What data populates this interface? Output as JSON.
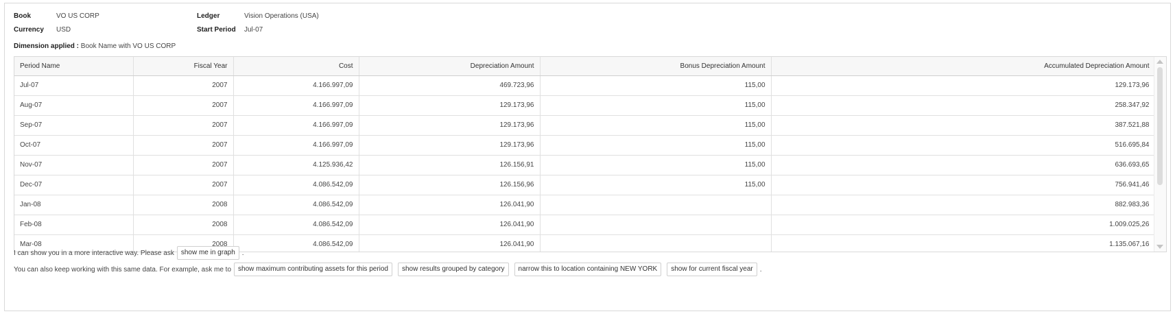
{
  "summary": {
    "book_label": "Book",
    "book_value": "VO US CORP",
    "currency_label": "Currency",
    "currency_value": "USD",
    "ledger_label": "Ledger",
    "ledger_value": "Vision Operations (USA)",
    "start_period_label": "Start Period",
    "start_period_value": "Jul-07"
  },
  "dimension": {
    "label": "Dimension applied :",
    "value": "Book Name with VO US CORP"
  },
  "table": {
    "headers": [
      "Period Name",
      "Fiscal Year",
      "Cost",
      "Depreciation Amount",
      "Bonus Depreciation Amount",
      "Accumulated Depreciation Amount"
    ],
    "rows": [
      [
        "Jul-07",
        "2007",
        "4.166.997,09",
        "469.723,96",
        "115,00",
        "129.173,96"
      ],
      [
        "Aug-07",
        "2007",
        "4.166.997,09",
        "129.173,96",
        "115,00",
        "258.347,92"
      ],
      [
        "Sep-07",
        "2007",
        "4.166.997,09",
        "129.173,96",
        "115,00",
        "387.521,88"
      ],
      [
        "Oct-07",
        "2007",
        "4.166.997,09",
        "129.173,96",
        "115,00",
        "516.695,84"
      ],
      [
        "Nov-07",
        "2007",
        "4.125.936,42",
        "126.156,91",
        "115,00",
        "636.693,65"
      ],
      [
        "Dec-07",
        "2007",
        "4.086.542,09",
        "126.156,96",
        "115,00",
        "756.941,46"
      ],
      [
        "Jan-08",
        "2008",
        "4.086.542,09",
        "126.041,90",
        "",
        "882.983,36"
      ],
      [
        "Feb-08",
        "2008",
        "4.086.542,09",
        "126.041,90",
        "",
        "1.009.025,26"
      ],
      [
        "Mar-08",
        "2008",
        "4.086.542,09",
        "126.041,90",
        "",
        "1.135.067,16"
      ]
    ]
  },
  "suggestions": {
    "graph_text": "I can show you in a more interactive way. Please ask",
    "graph_chip": "show me in graph",
    "graph_end": ".",
    "more_text": "You can also keep working with this same data. For example, ask me to",
    "chips": [
      "show maximum contributing assets for this period",
      "show results grouped by category",
      "narrow this to location containing NEW YORK",
      "show for current fiscal year"
    ],
    "more_end": "."
  }
}
